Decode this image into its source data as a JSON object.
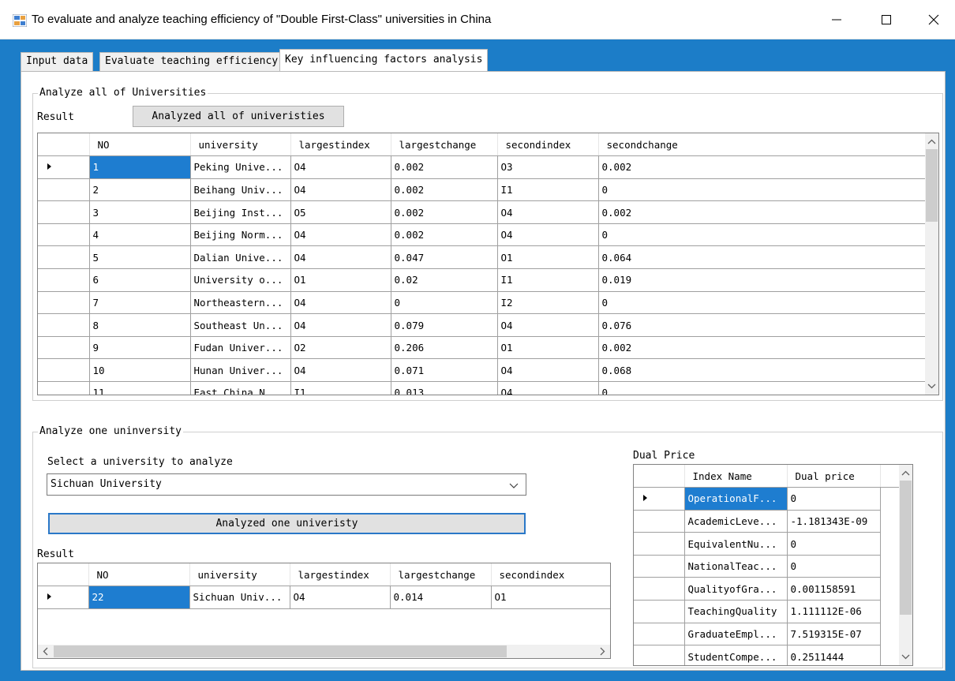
{
  "window": {
    "title": "To evaluate and analyze teaching efficiency of \"Double First-Class\" universities in China"
  },
  "tabs": [
    {
      "label": "Input data"
    },
    {
      "label": "Evaluate teaching efficiency"
    },
    {
      "label": "Key influencing factors analysis"
    }
  ],
  "analyze_all": {
    "group_title": "Analyze all of Universities",
    "result_label": "Result",
    "button_label": "Analyzed all of univeristies",
    "columns": [
      "NO",
      "university",
      "largestindex",
      "largestchange",
      "secondindex",
      "secondchange"
    ],
    "rows": [
      [
        "1",
        "Peking Unive...",
        "O4",
        "0.002",
        "O3",
        "0.002"
      ],
      [
        "2",
        "Beihang Univ...",
        "O4",
        "0.002",
        "I1",
        "0"
      ],
      [
        "3",
        "Beijing Inst...",
        "O5",
        "0.002",
        "O4",
        "0.002"
      ],
      [
        "4",
        "Beijing Norm...",
        "O4",
        "0.002",
        "O4",
        "0"
      ],
      [
        "5",
        "Dalian Unive...",
        "O4",
        "0.047",
        "O1",
        "0.064"
      ],
      [
        "6",
        "University o...",
        "O1",
        "0.02",
        "I1",
        "0.019"
      ],
      [
        "7",
        "Northeastern...",
        "O4",
        "0",
        "I2",
        "0"
      ],
      [
        "8",
        "Southeast Un...",
        "O4",
        "0.079",
        "O4",
        "0.076"
      ],
      [
        "9",
        "Fudan Univer...",
        "O2",
        "0.206",
        "O1",
        "0.002"
      ],
      [
        "10",
        "Hunan Univer...",
        "O4",
        "0.071",
        "O4",
        "0.068"
      ],
      [
        "11",
        "East China N...",
        "I1",
        "0.013",
        "O4",
        "0"
      ]
    ]
  },
  "analyze_one": {
    "group_title": "Analyze one uninversity",
    "select_label": "Select a university to analyze",
    "selected_university": "Sichuan University",
    "button_label": "Analyzed one univeristy",
    "result_label": "Result",
    "columns": [
      "NO",
      "university",
      "largestindex",
      "largestchange",
      "secondindex"
    ],
    "rows": [
      [
        "22",
        "Sichuan Univ...",
        "O4",
        "0.014",
        "O1"
      ]
    ]
  },
  "dual_price": {
    "label": "Dual Price",
    "columns": [
      "Index Name",
      "Dual price"
    ],
    "rows": [
      [
        "OperationalF...",
        "0"
      ],
      [
        "AcademicLeve...",
        "-1.181343E-09"
      ],
      [
        "EquivalentNu...",
        "0"
      ],
      [
        "NationalTeac...",
        "0"
      ],
      [
        "QualityofGra...",
        "0.001158591"
      ],
      [
        "TeachingQuality",
        "1.111112E-06"
      ],
      [
        "GraduateEmpl...",
        "7.519315E-07"
      ],
      [
        "StudentCompe...",
        "0.2511444"
      ]
    ]
  }
}
